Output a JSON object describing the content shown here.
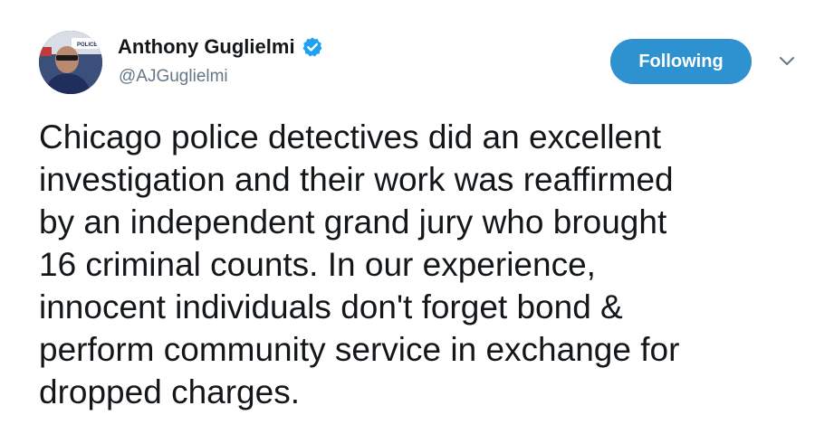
{
  "author": {
    "display_name": "Anthony Guglielmi",
    "handle": "@AJGuglielmi",
    "verified": true,
    "avatar_badge_text": "POLICE"
  },
  "follow_button": {
    "label": "Following"
  },
  "tweet": {
    "lines": [
      "Chicago police detectives did an excellent",
      "investigation and their work was reaffirmed",
      "by an independent grand jury who brought",
      "16 criminal counts. In our experience,",
      "innocent individuals don't forget bond &",
      "perform community service in exchange for",
      "dropped charges."
    ]
  },
  "icons": {
    "verified": "verified-badge-icon",
    "more": "chevron-down-icon"
  },
  "colors": {
    "accent": "#2d92cf",
    "text": "#14171a",
    "secondary_text": "#657786"
  }
}
